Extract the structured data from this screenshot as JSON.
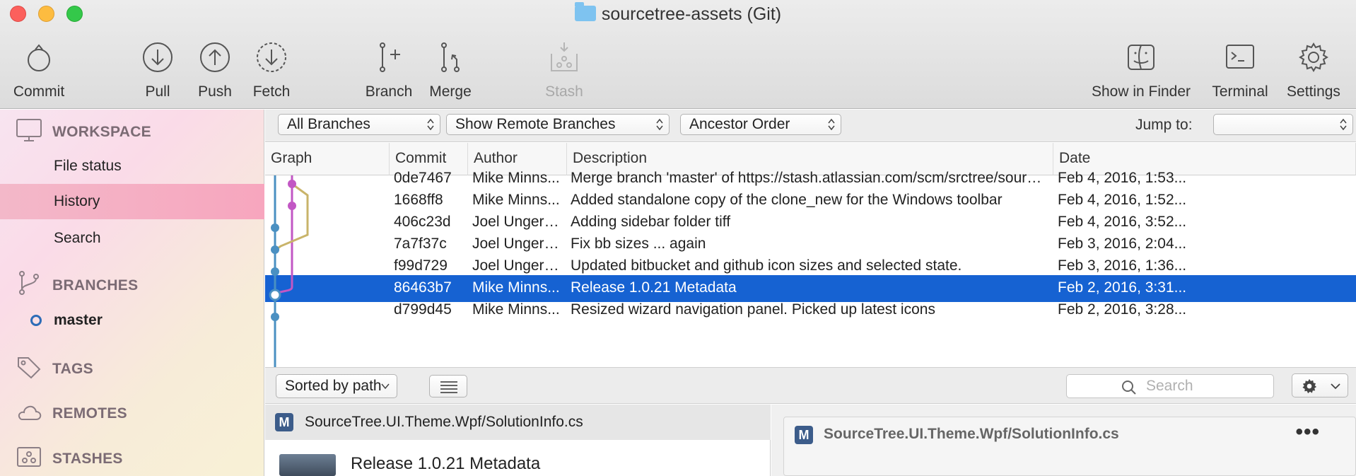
{
  "window": {
    "title": "sourcetree-assets (Git)"
  },
  "toolbar": {
    "commit": "Commit",
    "pull": "Pull",
    "push": "Push",
    "fetch": "Fetch",
    "branch": "Branch",
    "merge": "Merge",
    "stash": "Stash",
    "show_in_finder": "Show in Finder",
    "terminal": "Terminal",
    "settings": "Settings"
  },
  "sidebar": {
    "workspace": "WORKSPACE",
    "file_status": "File status",
    "history": "History",
    "search": "Search",
    "branches": "BRANCHES",
    "master": "master",
    "tags": "TAGS",
    "remotes": "REMOTES",
    "stashes": "STASHES"
  },
  "filters": {
    "branches": "All Branches",
    "remote": "Show Remote Branches",
    "order": "Ancestor Order",
    "jump_to": "Jump to:"
  },
  "table": {
    "headers": {
      "graph": "Graph",
      "commit": "Commit",
      "author": "Author",
      "description": "Description",
      "date": "Date"
    },
    "rows": [
      {
        "commit": "0de7467",
        "author": "Mike Minns...",
        "description": "Merge branch 'master' of https://stash.atlassian.com/scm/srctree/sourcetree...",
        "date": "Feb 4, 2016, 1:53..."
      },
      {
        "commit": "1668ff8",
        "author": "Mike Minns...",
        "description": "Added standalone copy of the clone_new for the Windows toolbar",
        "date": "Feb 4, 2016, 1:52..."
      },
      {
        "commit": "406c23d",
        "author": "Joel Unger <...",
        "description": "Adding sidebar folder tiff",
        "date": "Feb 4, 2016, 3:52..."
      },
      {
        "commit": "7a7f37c",
        "author": "Joel Unger <...",
        "description": "Fix bb sizes ... again",
        "date": "Feb 3, 2016, 2:04..."
      },
      {
        "commit": "f99d729",
        "author": "Joel Unger <...",
        "description": "Updated bitbucket and github icon sizes and selected state.",
        "date": "Feb 3, 2016, 1:36..."
      },
      {
        "commit": "86463b7",
        "author": "Mike Minns...",
        "description": "Release 1.0.21 Metadata",
        "date": "Feb 2, 2016, 3:31..."
      },
      {
        "commit": "d799d45",
        "author": "Mike Minns...",
        "description": "Resized wizard navigation panel. Picked up latest icons",
        "date": "Feb 2, 2016, 3:28..."
      }
    ]
  },
  "lowerbar": {
    "sort": "Sorted by path",
    "search_placeholder": "Search"
  },
  "file_pane": {
    "badge": "M",
    "file": "SourceTree.UI.Theme.Wpf/SolutionInfo.cs",
    "commit_title": "Release 1.0.21 Metadata"
  },
  "diff_pane": {
    "badge": "M",
    "file": "SourceTree.UI.Theme.Wpf/SolutionInfo.cs",
    "more": "•••"
  },
  "colors": {
    "selection": "#1662d2",
    "graph_blue": "#4a90c2",
    "graph_magenta": "#c257c4",
    "graph_olive": "#c9b46a"
  }
}
